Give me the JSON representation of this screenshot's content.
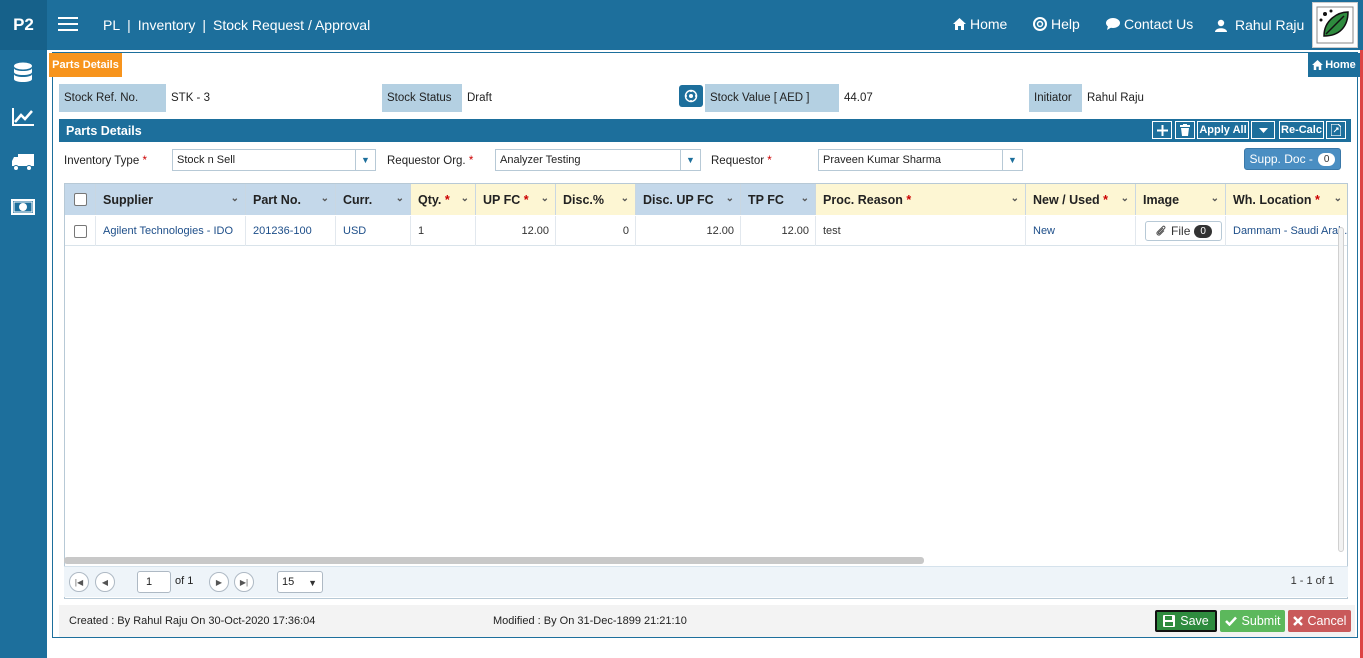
{
  "app": {
    "logo": "P2",
    "menu_icon": "hamburger-icon"
  },
  "breadcrumb": {
    "items": [
      "PL",
      "Inventory",
      "Stock Request / Approval"
    ],
    "separator": "|"
  },
  "topnav": {
    "home": "Home",
    "help": "Help",
    "contact": "Contact Us",
    "user": "Rahul Raju"
  },
  "sidebar": {
    "icons": [
      "database-icon",
      "chart-line-icon",
      "truck-icon",
      "money-icon"
    ]
  },
  "tab": {
    "label": "Parts Details"
  },
  "home_button": "Home",
  "header": {
    "ref_label": "Stock Ref. No.",
    "ref_value": "STK - 3",
    "status_label": "Stock Status",
    "status_value": "Draft",
    "value_label": "Stock Value [ AED ]",
    "value_value": "44.07",
    "initiator_label": "Initiator",
    "initiator_value": "Rahul Raju"
  },
  "section": {
    "title": "Parts Details",
    "apply_all": "Apply All",
    "recalc": "Re-Calc"
  },
  "filters": {
    "inventory_type_label": "Inventory Type",
    "inventory_type_value": "Stock n Sell",
    "requestor_org_label": "Requestor Org.",
    "requestor_org_value": "Analyzer Testing",
    "requestor_label": "Requestor",
    "requestor_value": "Praveen Kumar Sharma",
    "required_mark": "*",
    "supp_doc_label": "Supp. Doc -",
    "supp_doc_count": "0"
  },
  "grid": {
    "columns": [
      {
        "label": "Supplier",
        "required": ""
      },
      {
        "label": "Part No.",
        "required": ""
      },
      {
        "label": "Curr.",
        "required": ""
      },
      {
        "label": "Qty.",
        "required": "*"
      },
      {
        "label": "UP FC",
        "required": "*"
      },
      {
        "label": "Disc.%",
        "required": ""
      },
      {
        "label": "Disc. UP FC",
        "required": ""
      },
      {
        "label": "TP FC",
        "required": ""
      },
      {
        "label": "Proc. Reason",
        "required": "*"
      },
      {
        "label": "New / Used",
        "required": "*"
      },
      {
        "label": "Image",
        "required": ""
      },
      {
        "label": "Wh. Location",
        "required": "*"
      }
    ],
    "rows": [
      {
        "supplier": "Agilent Technologies - IDO",
        "part_no": "201236-100",
        "curr": "USD",
        "qty": "1",
        "up_fc": "12.00",
        "disc_pct": "0",
        "disc_up_fc": "12.00",
        "tp_fc": "12.00",
        "proc_reason": "test",
        "new_used": "New",
        "image_label": "File",
        "image_count": "0",
        "wh_location": "Dammam - Saudi Arab."
      }
    ]
  },
  "pager": {
    "page": "1",
    "of_text": "of 1",
    "page_size": "15",
    "range_text": "1 - 1 of 1"
  },
  "footer": {
    "created": "Created : By Rahul Raju On 30-Oct-2020 17:36:04",
    "modified": "Modified : By On 31-Dec-1899 21:21:10",
    "save": "Save",
    "submit": "Submit",
    "cancel": "Cancel"
  },
  "colors": {
    "primary": "#1d6f9c",
    "accent_orange": "#f7941d",
    "save": "#2e8b3e",
    "submit": "#5cb85c",
    "cancel": "#c9595a"
  }
}
